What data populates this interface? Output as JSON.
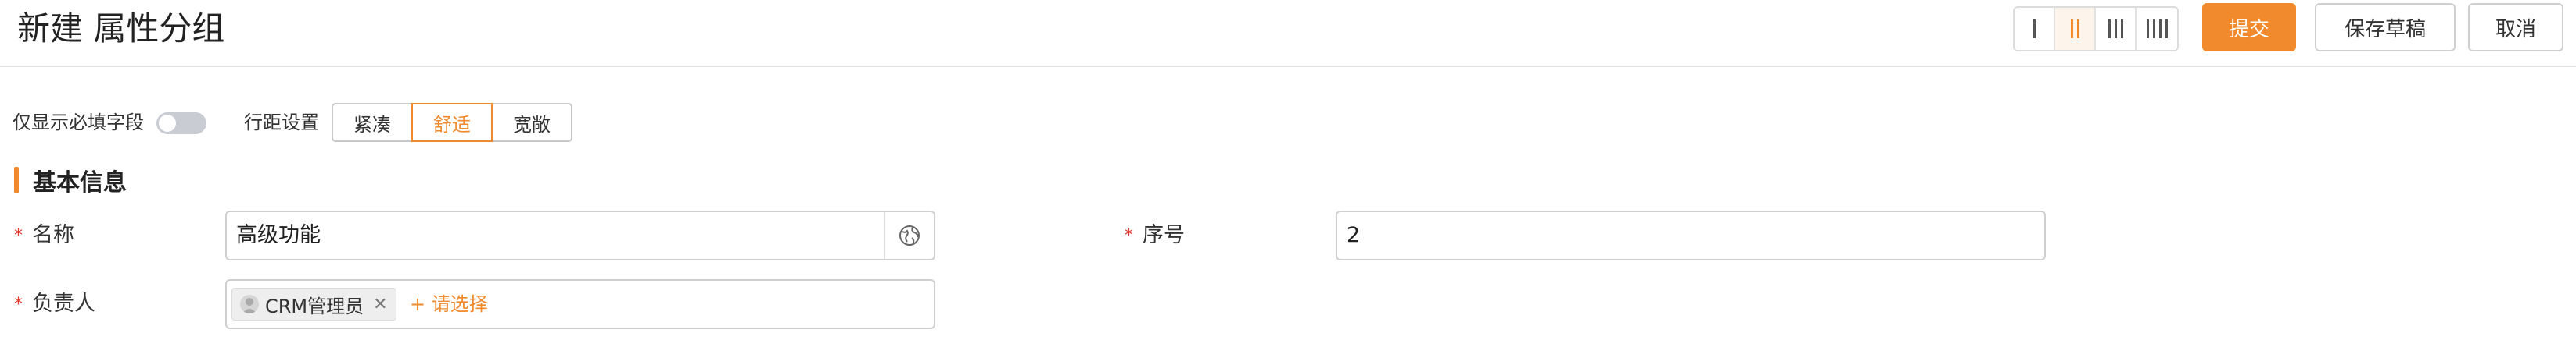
{
  "header": {
    "title": "新建 属性分组",
    "layout_options": [
      {
        "name": "layout-1-column",
        "bars": 1,
        "active": false
      },
      {
        "name": "layout-2-column",
        "bars": 2,
        "active": true
      },
      {
        "name": "layout-3-column",
        "bars": 3,
        "active": false
      },
      {
        "name": "layout-4-column",
        "bars": 4,
        "active": false
      }
    ],
    "submit_label": "提交",
    "save_draft_label": "保存草稿",
    "cancel_label": "取消"
  },
  "toolbar": {
    "required_only_label": "仅显示必填字段",
    "required_only_on": false,
    "row_spacing_label": "行距设置",
    "row_spacing_options": [
      "紧凑",
      "舒适",
      "宽敞"
    ],
    "row_spacing_selected": "舒适"
  },
  "section": {
    "title": "基本信息"
  },
  "fields": {
    "name": {
      "label": "名称",
      "required": true,
      "value": "高级功能"
    },
    "order": {
      "label": "序号",
      "required": true,
      "value": "2"
    },
    "owner": {
      "label": "负责人",
      "required": true,
      "tag": "CRM管理员",
      "add_label": "+ 请选择"
    }
  },
  "colors": {
    "accent": "#f08a2c",
    "required": "#e5372b"
  },
  "icons": {
    "translate": "globe-icon",
    "avatar": "user-avatar-icon",
    "remove": "close-icon"
  }
}
